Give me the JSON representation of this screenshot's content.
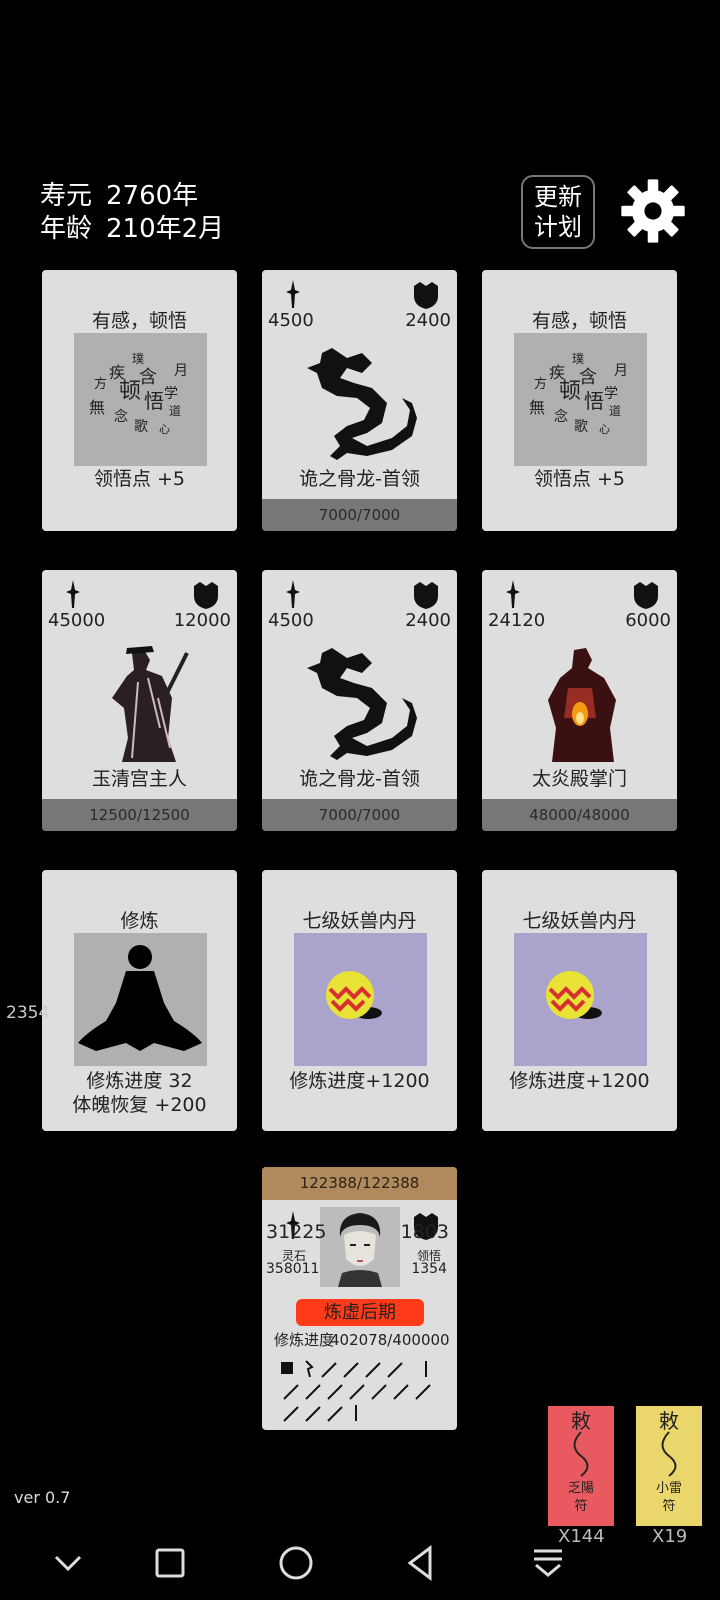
{
  "status": {
    "lifespan_label": "寿元",
    "lifespan_value": "2760年",
    "age_label": "年龄",
    "age_value": "210年2月"
  },
  "header": {
    "update_plan_line1": "更新",
    "update_plan_line2": "计划",
    "settings_icon": "gear-icon"
  },
  "cards": [
    {
      "type": "insight",
      "title": "有感，顿悟",
      "footer": "领悟点 +5"
    },
    {
      "type": "enemy",
      "attack": "4500",
      "defense": "2400",
      "name": "诡之骨龙-首领",
      "hp": "7000/7000"
    },
    {
      "type": "insight",
      "title": "有感，顿悟",
      "footer": "领悟点 +5"
    },
    {
      "type": "enemy",
      "attack": "45000",
      "defense": "12000",
      "name": "玉清宫主人",
      "hp": "12500/12500"
    },
    {
      "type": "enemy",
      "attack": "4500",
      "defense": "2400",
      "name": "诡之骨龙-首领",
      "hp": "7000/7000"
    },
    {
      "type": "enemy",
      "attack": "24120",
      "defense": "6000",
      "name": "太炎殿掌门",
      "hp": "48000/48000"
    },
    {
      "type": "cultivate",
      "title": "修炼",
      "footer1": "修炼进度  32",
      "footer2": "体魄恢复 +200"
    },
    {
      "type": "item",
      "title": "七级妖兽内丹",
      "footer": "修炼进度+1200"
    },
    {
      "type": "item",
      "title": "七级妖兽内丹",
      "footer": "修炼进度+1200"
    }
  ],
  "side_number": "2354",
  "player": {
    "hp": "122388/122388",
    "attack": "31225",
    "defense": "1803",
    "spirit_stone_label": "灵石",
    "spirit_stone_value": "358011",
    "insight_label": "领悟",
    "insight_value": "1354",
    "realm": "炼虚后期",
    "progress_label": "修炼进度",
    "progress_value": "402078/400000"
  },
  "talismans": [
    {
      "top": "敕",
      "name": "乏陽",
      "sub": "符",
      "count": "X144",
      "color": "#e85a5f"
    },
    {
      "top": "敕",
      "name": "小雷",
      "sub": "符",
      "count": "X19",
      "color": "#ead66a"
    }
  ],
  "version": "ver 0.7"
}
